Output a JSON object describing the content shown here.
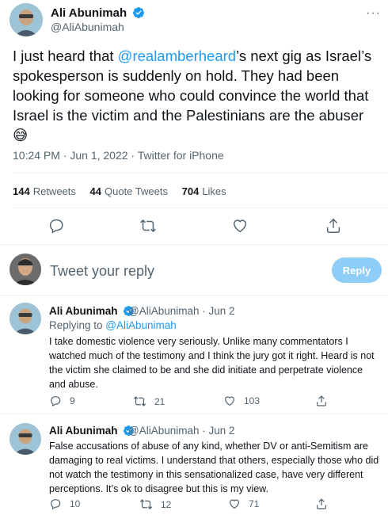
{
  "main_tweet": {
    "author_name": "Ali Abunimah",
    "handle": "@AliAbunimah",
    "text_pre": "I just heard that ",
    "mention": "@realamberheard",
    "text_post": "’s next gig as Israel’s spokesperson is suddenly on hold. They had been looking for someone who could convince the world that Israel is the victim and the Palestinians are the abuser",
    "emoji": "😅",
    "timestamp": "10:24 PM · Jun 1, 2022 · Twitter for iPhone",
    "stats": {
      "retweets_count": "144",
      "retweets_label": "Retweets",
      "quotes_count": "44",
      "quotes_label": "Quote Tweets",
      "likes_count": "704",
      "likes_label": "Likes"
    },
    "more_label": "···"
  },
  "compose": {
    "placeholder": "Tweet your reply",
    "button_label": "Reply"
  },
  "replies": [
    {
      "author_name": "Ali Abunimah",
      "handle_date": "@AliAbunimah · Jun 2",
      "replying_prefix": "Replying to ",
      "replying_to": "@AliAbunimah",
      "text": "I take domestic violence very seriously. Unlike many commentators I watched much of the testimony and I think the jury got it right. Heard is not the victim she claimed to be and she did initiate and perpetrate violence and abuse.",
      "reply_count": "9",
      "retweet_count": "21",
      "like_count": "103"
    },
    {
      "author_name": "Ali Abunimah",
      "handle_date": "@AliAbunimah · Jun 2",
      "text": "False accusations of abuse of any kind, whether DV or anti-Semitism are damaging to real victims. I understand that others, especially those who did not watch the testimony in this sensationalized case, have very different perceptions. It’s ok to disagree but this is my view.",
      "reply_count": "10",
      "retweet_count": "12",
      "like_count": "71"
    }
  ],
  "colors": {
    "accent": "#1d9bf0",
    "text": "#0f1419",
    "muted": "#536471",
    "divider": "#eff3f4",
    "reply_button_disabled": "#8ecdf7"
  },
  "icons": [
    "verified-badge-icon",
    "more-icon",
    "reply-icon",
    "retweet-icon",
    "like-icon",
    "share-icon"
  ]
}
